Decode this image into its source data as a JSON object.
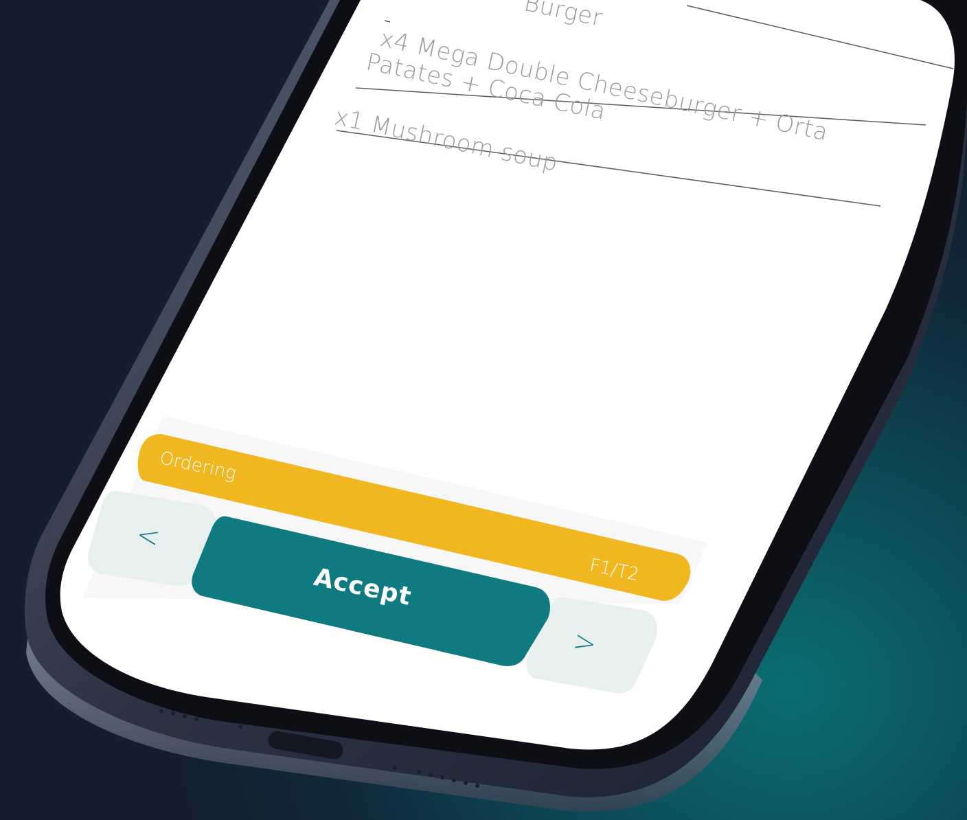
{
  "order": {
    "items": [
      "Burger",
      "x4 Mega Double Cheeseburger + Orta",
      "Patates + Coca Cola",
      "x1 Mushroom soup"
    ]
  },
  "status": {
    "label": "Ordering",
    "table": "F1/T2",
    "color": "#f0b720"
  },
  "actions": {
    "accept_label": "Accept",
    "prev_glyph": "<",
    "next_glyph": ">",
    "accept_color": "#0f7b80"
  }
}
